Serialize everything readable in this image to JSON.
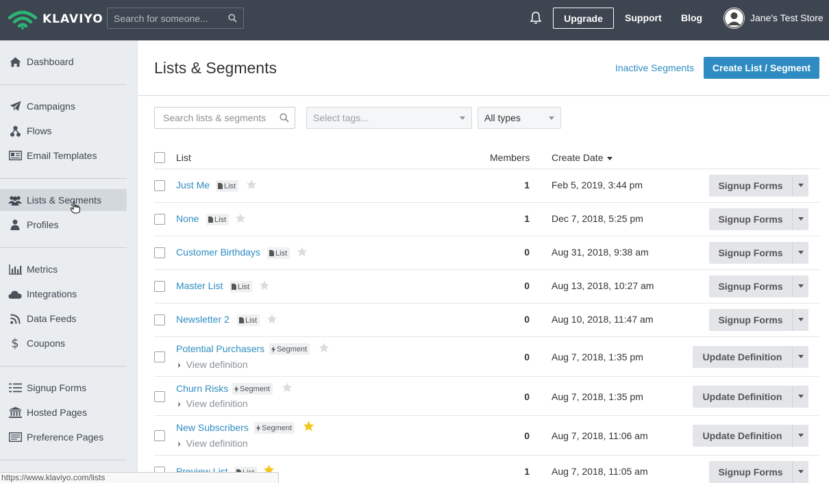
{
  "topbar": {
    "logo_text": "KLAVIYO",
    "search_placeholder": "Search for someone...",
    "upgrade_label": "Upgrade",
    "support_label": "Support",
    "blog_label": "Blog",
    "store_name": "Jane's Test Store"
  },
  "sidebar": {
    "items": [
      {
        "label": "Dashboard",
        "icon": "home-icon"
      },
      {
        "label": "Campaigns",
        "icon": "paper-plane-icon"
      },
      {
        "label": "Flows",
        "icon": "flows-icon"
      },
      {
        "label": "Email Templates",
        "icon": "email-template-icon"
      },
      {
        "label": "Lists & Segments",
        "icon": "users-icon",
        "active": true
      },
      {
        "label": "Profiles",
        "icon": "user-icon"
      },
      {
        "label": "Metrics",
        "icon": "bar-chart-icon"
      },
      {
        "label": "Integrations",
        "icon": "cloud-icon"
      },
      {
        "label": "Data Feeds",
        "icon": "rss-icon"
      },
      {
        "label": "Coupons",
        "icon": "dollar-icon"
      },
      {
        "label": "Signup Forms",
        "icon": "list-form-icon"
      },
      {
        "label": "Hosted Pages",
        "icon": "bank-icon"
      },
      {
        "label": "Preference Pages",
        "icon": "preferences-icon"
      }
    ]
  },
  "main": {
    "title": "Lists & Segments",
    "inactive_link": "Inactive Segments",
    "create_button": "Create List / Segment",
    "filters": {
      "search_placeholder": "Search lists & segments",
      "tags_placeholder": "Select tags...",
      "type_selected": "All types"
    },
    "table": {
      "col_list": "List",
      "col_members": "Members",
      "col_date": "Create Date",
      "rows": [
        {
          "name": "Just Me",
          "type": "List",
          "starred": false,
          "members": "1",
          "date": "Feb 5, 2019, 3:44 pm",
          "action": "Signup Forms"
        },
        {
          "name": "None",
          "type": "List",
          "starred": false,
          "members": "1",
          "date": "Dec 7, 2018, 5:25 pm",
          "action": "Signup Forms"
        },
        {
          "name": "Customer Birthdays",
          "type": "List",
          "starred": false,
          "members": "0",
          "date": "Aug 31, 2018, 9:38 am",
          "action": "Signup Forms"
        },
        {
          "name": "Master List",
          "type": "List",
          "starred": false,
          "members": "0",
          "date": "Aug 13, 2018, 10:27 am",
          "action": "Signup Forms"
        },
        {
          "name": "Newsletter 2",
          "type": "List",
          "starred": false,
          "members": "0",
          "date": "Aug 10, 2018, 11:47 am",
          "action": "Signup Forms"
        },
        {
          "name": "Potential Purchasers",
          "type": "Segment",
          "starred": false,
          "members": "0",
          "date": "Aug 7, 2018, 1:35 pm",
          "action": "Update Definition",
          "view_definition": "View definition"
        },
        {
          "name": "Churn Risks",
          "type": "Segment",
          "starred": false,
          "members": "0",
          "date": "Aug 7, 2018, 1:35 pm",
          "action": "Update Definition",
          "view_definition": "View definition"
        },
        {
          "name": "New Subscribers",
          "type": "Segment",
          "starred": true,
          "members": "0",
          "date": "Aug 7, 2018, 11:06 am",
          "action": "Update Definition",
          "view_definition": "View definition"
        },
        {
          "name": "Preview List",
          "type": "List",
          "starred": true,
          "members": "1",
          "date": "Aug 7, 2018, 11:05 am",
          "action": "Signup Forms"
        }
      ]
    }
  },
  "status_bar": {
    "url": "https://www.klaviyo.com/lists"
  },
  "colors": {
    "topbar": "#3d4550",
    "accent": "#2e8cc2",
    "logo_green": "#2bb673",
    "star_active": "#f5c518",
    "star_inactive": "#dadde0"
  }
}
